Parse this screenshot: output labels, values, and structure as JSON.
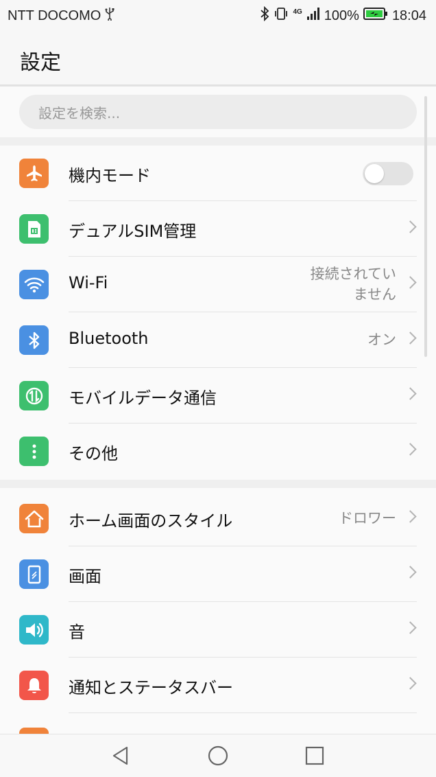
{
  "status_bar": {
    "carrier": "NTT DOCOMO",
    "usb_icon": "usb-icon",
    "bluetooth_icon": "bluetooth-icon",
    "vibrate_icon": "vibrate-icon",
    "network_type": "4G",
    "signal_icon": "signal-icon",
    "battery_percent": "100%",
    "battery_icon": "battery-charging-icon",
    "time": "18:04"
  },
  "header": {
    "title": "設定"
  },
  "search": {
    "placeholder": "設定を検索..."
  },
  "sections": [
    {
      "items": [
        {
          "key": "airplane",
          "label": "機内モード",
          "icon": "airplane-icon",
          "color": "#f0833a",
          "control": "toggle",
          "toggle_on": false
        },
        {
          "key": "dual-sim",
          "label": "デュアルSIM管理",
          "icon": "sim-card-icon",
          "color": "#3dbf6e",
          "control": "chevron"
        },
        {
          "key": "wifi",
          "label": "Wi-Fi",
          "icon": "wifi-icon",
          "color": "#4a90e2",
          "control": "chevron",
          "value_lines": [
            "接続されてい",
            "ません"
          ]
        },
        {
          "key": "bluetooth",
          "label": "Bluetooth",
          "icon": "bluetooth-icon",
          "color": "#4a90e2",
          "control": "chevron",
          "value": "オン"
        },
        {
          "key": "mobile-data",
          "label": "モバイルデータ通信",
          "icon": "mobile-data-icon",
          "color": "#3dbf6e",
          "control": "chevron"
        },
        {
          "key": "other",
          "label": "その他",
          "icon": "more-dots-icon",
          "color": "#3dbf6e",
          "control": "chevron"
        }
      ]
    },
    {
      "items": [
        {
          "key": "home-style",
          "label": "ホーム画面のスタイル",
          "icon": "home-icon",
          "color": "#f0833a",
          "control": "chevron",
          "value": "ドロワー"
        },
        {
          "key": "display",
          "label": "画面",
          "icon": "display-icon",
          "color": "#4a90e2",
          "control": "chevron"
        },
        {
          "key": "sound",
          "label": "音",
          "icon": "speaker-icon",
          "color": "#2fb8c9",
          "control": "chevron"
        },
        {
          "key": "notifications",
          "label": "通知とステータスバー",
          "icon": "bell-icon",
          "color": "#f2564a",
          "control": "chevron"
        }
      ]
    }
  ],
  "nav": {
    "back_icon": "back-triangle-icon",
    "home_icon": "home-circle-icon",
    "recents_icon": "recents-square-icon"
  }
}
